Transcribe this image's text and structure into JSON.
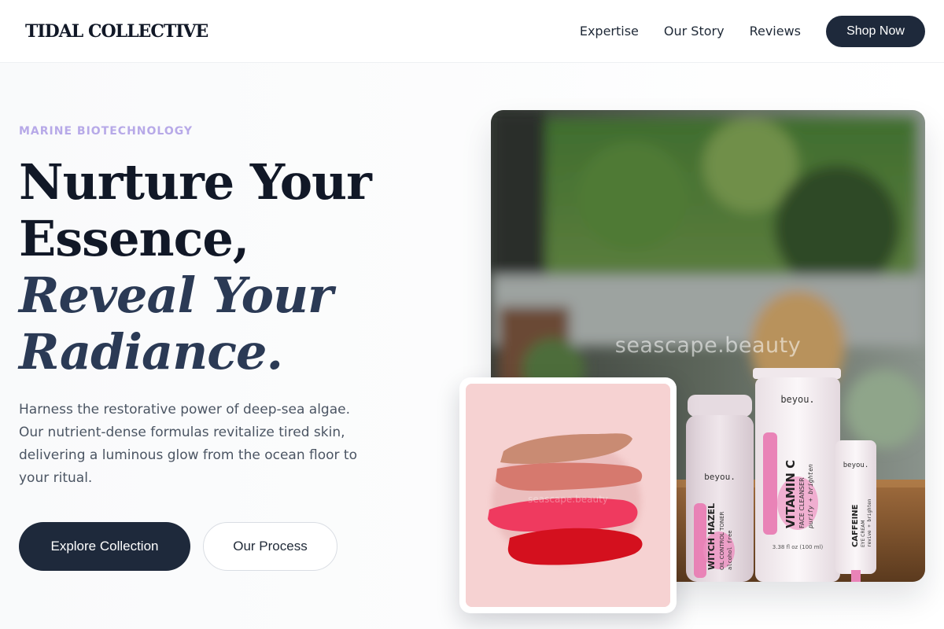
{
  "brand": {
    "name": "TIDAL COLLECTIVE"
  },
  "nav": {
    "links": [
      "Expertise",
      "Our Story",
      "Reviews"
    ],
    "cta_label": "Shop Now"
  },
  "hero": {
    "eyebrow": "MARINE BIOTECHNOLOGY",
    "headline_lines": [
      "Nurture Your",
      "Essence,"
    ],
    "headline_italic_lines": [
      "Reveal Your",
      "Radiance."
    ],
    "description": "Harness the restorative power of deep-sea algae. Our nutrient-dense formulas revitalize tired skin, delivering a luminous glow from the ocean floor to your ritual.",
    "primary_cta": "Explore Collection",
    "secondary_cta": "Our Process"
  },
  "product_image": {
    "watermark": "seascape.beauty",
    "brand_on_products": "beyou.",
    "products": [
      {
        "name": "WITCH HAZEL",
        "subtitle": "OIL CONTROL TONER",
        "note": "alcohol free"
      },
      {
        "name": "VITAMIN C",
        "subtitle": "FACE CLEANSER",
        "note": "purify + brighten",
        "size": "3.38 fl oz (100 ml)"
      },
      {
        "name": "CAFFEINE",
        "subtitle": "EYE CREAM",
        "note": "revive + brighten"
      }
    ]
  },
  "swatch_image": {
    "watermark": "seascape.beauty"
  },
  "colors": {
    "primary_dark": "#1e293b",
    "eyebrow": "#b7a9e8",
    "body_text": "#4b5563",
    "swatch_bg": "#f6d2d2"
  }
}
